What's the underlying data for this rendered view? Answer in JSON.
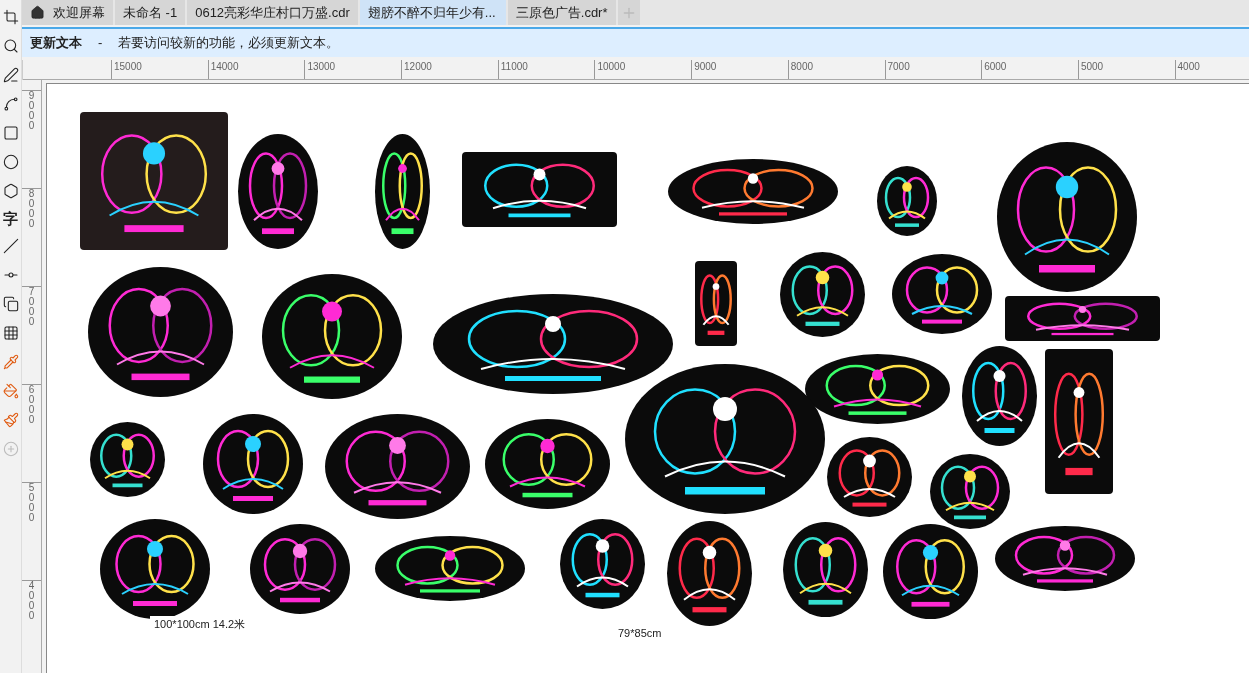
{
  "tabs": [
    {
      "label": "欢迎屏幕",
      "kind": "home",
      "selected": false
    },
    {
      "label": "未命名 -1",
      "kind": "doc",
      "selected": false
    },
    {
      "label": "0612亮彩华庄村口万盛.cdr",
      "kind": "doc",
      "selected": false
    },
    {
      "label": "翅膀不醉不归年少有...",
      "kind": "doc",
      "selected": true
    },
    {
      "label": "三原色广告.cdr*",
      "kind": "doc",
      "selected": false
    }
  ],
  "info_bar": {
    "title": "更新文本",
    "separator": "-",
    "message": "若要访问较新的功能，必须更新文本。"
  },
  "toolbox": [
    {
      "kind": "crop"
    },
    {
      "kind": "zoom"
    },
    {
      "kind": "freehand"
    },
    {
      "kind": "bezier"
    },
    {
      "kind": "rectangle"
    },
    {
      "kind": "ellipse"
    },
    {
      "kind": "polygon"
    },
    {
      "kind": "text",
      "label": "字"
    },
    {
      "kind": "line"
    },
    {
      "kind": "connector"
    },
    {
      "kind": "shadow"
    },
    {
      "kind": "transparency"
    },
    {
      "kind": "eyedropper"
    },
    {
      "kind": "fill"
    },
    {
      "kind": "smartfill"
    },
    {
      "kind": "add"
    }
  ],
  "ruler_h": [
    "15000",
    "14000",
    "13000",
    "12000",
    "11000",
    "10000",
    "9000",
    "8000",
    "7000",
    "6000",
    "5000",
    "4000"
  ],
  "ruler_v": [
    "9000",
    "8000",
    "7000",
    "6000",
    "5000",
    "4000"
  ],
  "canvas": {
    "captions": [
      "100*100cm  14.2米",
      "79*85cm"
    ]
  }
}
